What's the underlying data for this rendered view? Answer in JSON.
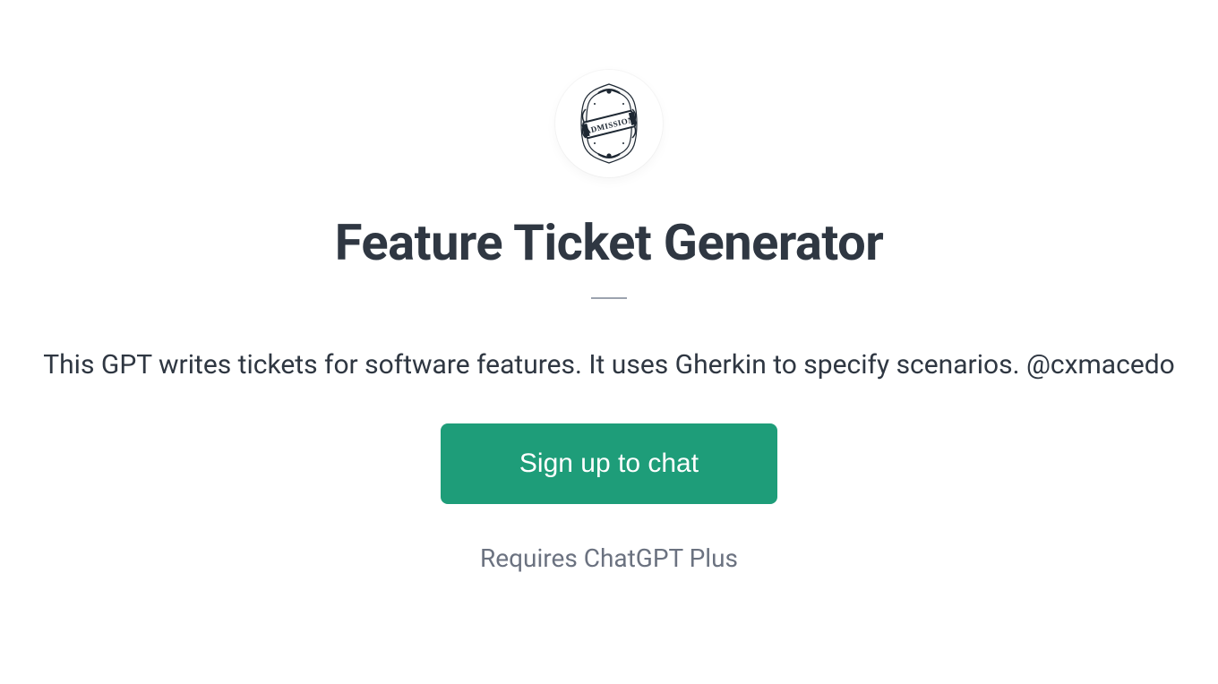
{
  "logo": {
    "name": "admission-ticket-badge",
    "label": "ADMISSION"
  },
  "header": {
    "title": "Feature Ticket Generator"
  },
  "description": "This GPT writes tickets for software features. It uses Gherkin to specify scenarios. @cxmacedo",
  "cta": {
    "label": "Sign up to chat"
  },
  "subtext": "Requires ChatGPT Plus",
  "colors": {
    "primary": "#1E9D79",
    "title": "#2F3742",
    "muted": "#6B7280",
    "divider": "#9CA3AF"
  }
}
